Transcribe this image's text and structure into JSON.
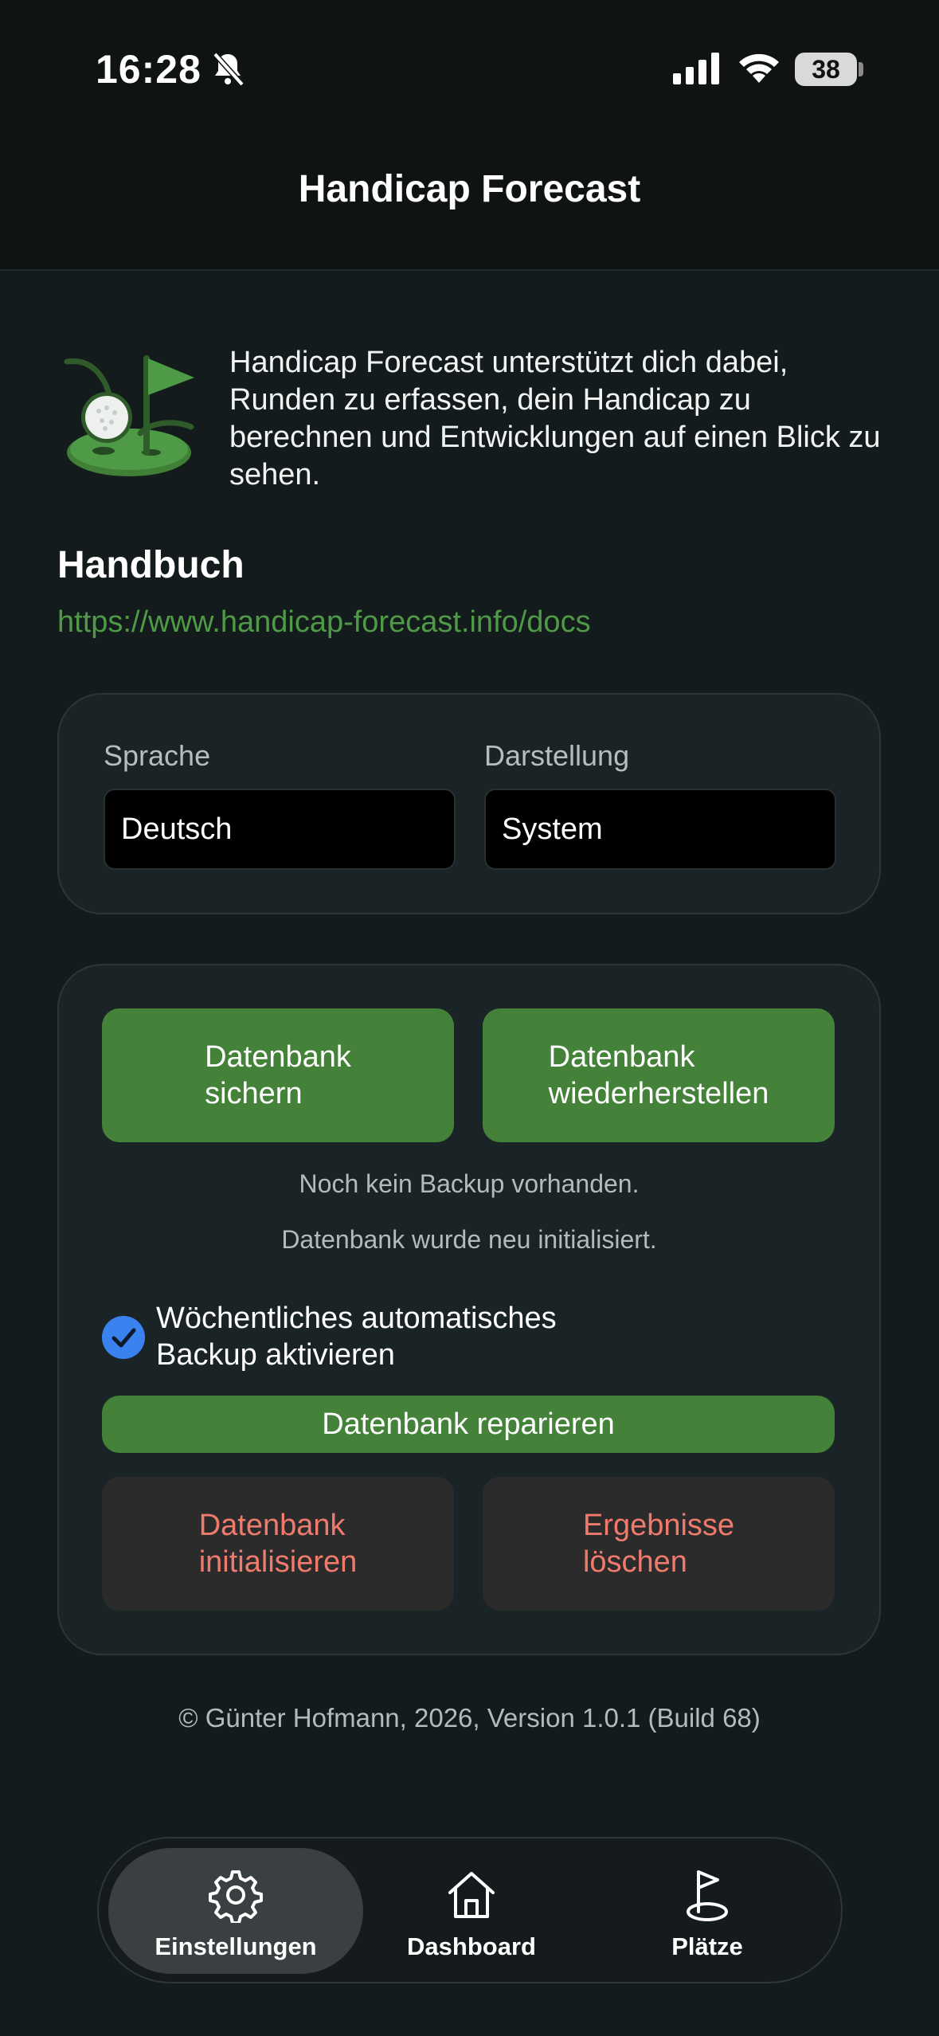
{
  "status_bar": {
    "time": "16:28",
    "battery": "38"
  },
  "header": {
    "title": "Handicap Forecast"
  },
  "intro": {
    "text": "Handicap Forecast unterstützt dich dabei, Runden zu erfassen, dein Handicap zu berechnen und Entwicklungen auf einen Blick zu sehen."
  },
  "manual": {
    "title": "Handbuch",
    "link": "https://www.handicap-forecast.info/docs"
  },
  "settings": {
    "language_label": "Sprache",
    "language_value": "Deutsch",
    "appearance_label": "Darstellung",
    "appearance_value": "System"
  },
  "database": {
    "backup_line1": "Datenbank",
    "backup_line2": "sichern",
    "restore_line1": "Datenbank",
    "restore_line2": "wiederherstellen",
    "no_backup_text": "Noch kein Backup vorhanden.",
    "initialized_text": "Datenbank wurde neu initialisiert.",
    "auto_backup_line1": "Wöchentliches automatisches",
    "auto_backup_line2": "Backup aktivieren",
    "auto_backup_checked": true,
    "repair_label": "Datenbank reparieren",
    "init_line1": "Datenbank",
    "init_line2": "initialisieren",
    "delete_line1": "Ergebnisse",
    "delete_line2": "löschen"
  },
  "footer": {
    "text": "© Günter Hofmann, 2026, Version 1.0.1 (Build 68)"
  },
  "tabbar": {
    "items": [
      {
        "label": "Einstellungen",
        "icon": "gear-icon",
        "active": true
      },
      {
        "label": "Dashboard",
        "icon": "home-icon",
        "active": false
      },
      {
        "label": "Plätze",
        "icon": "flag-icon",
        "active": false
      }
    ]
  },
  "colors": {
    "background": "#141b1d",
    "accent_green": "#44823a",
    "link_green": "#4f9a46",
    "danger_text": "#f07a6c",
    "checkbox_blue": "#3a82f0"
  }
}
